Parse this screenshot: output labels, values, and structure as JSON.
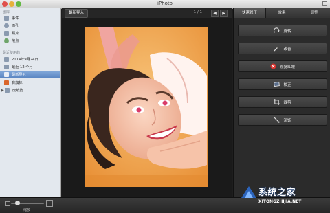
{
  "window": {
    "title": "iPhoto"
  },
  "sidebar": {
    "library_heading": "图库",
    "library_items": [
      {
        "label": "事件",
        "icon": "events-icon"
      },
      {
        "label": "面孔",
        "icon": "faces-icon"
      },
      {
        "label": "照片",
        "icon": "photos-icon"
      },
      {
        "label": "地点",
        "icon": "places-icon"
      }
    ],
    "recent_heading": "最近使用的",
    "recent_items": [
      {
        "label": "2014年9月24日",
        "icon": "event-icon"
      },
      {
        "label": "最近 12 个月",
        "icon": "calendar-icon"
      },
      {
        "label": "最新导入",
        "icon": "import-icon",
        "selected": true
      },
      {
        "label": "有旗标",
        "icon": "flag-icon"
      },
      {
        "label": "废纸篓",
        "icon": "trash-icon",
        "disclosure": "▶"
      }
    ]
  },
  "toolbar": {
    "tag_label": "最新导入",
    "pager": "1 / 1",
    "prev_label": "◀",
    "next_label": "▶"
  },
  "right_panel": {
    "tabs": [
      "快速修正",
      "效果",
      "调整"
    ],
    "active_tab": 0,
    "buttons": [
      {
        "label": "旋转",
        "icon": "rotate-icon"
      },
      {
        "label": "改善",
        "icon": "enhance-icon"
      },
      {
        "label": "修复红眼",
        "icon": "red-eye-icon"
      },
      {
        "label": "校正",
        "icon": "straighten-icon"
      },
      {
        "label": "裁剪",
        "icon": "crop-icon"
      },
      {
        "label": "润饰",
        "icon": "retouch-icon"
      }
    ]
  },
  "bottom": {
    "zoom_label": "缩放",
    "zoom_level": 0.2
  },
  "watermark": {
    "line1": "系统之家",
    "line2": "XITONGZHIJIA.NET"
  },
  "colors": {
    "selection": "#5b86c3",
    "red_eye": "#d9302c",
    "photo_bg": "#f2a64b"
  }
}
